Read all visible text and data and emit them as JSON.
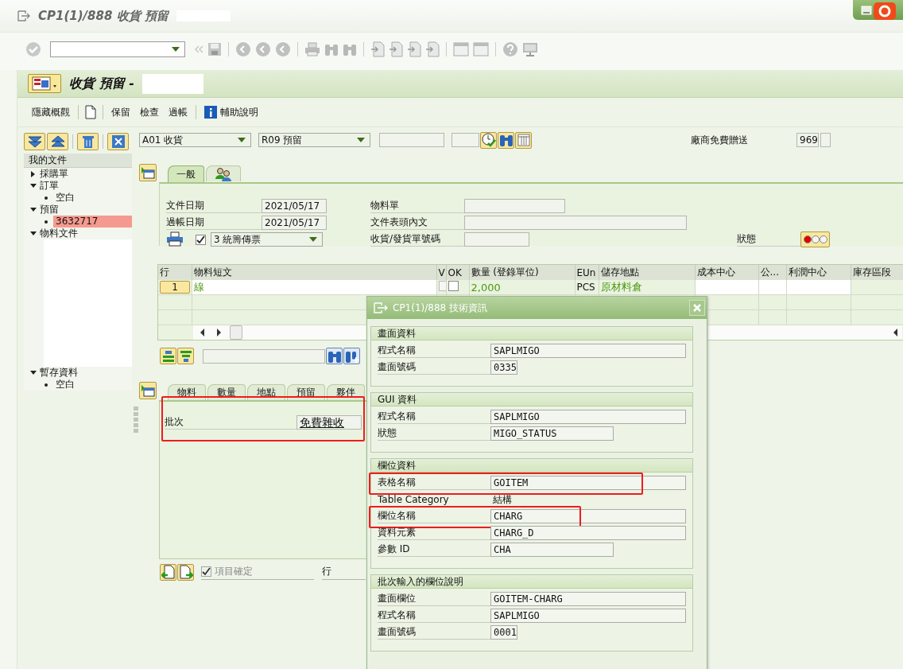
{
  "window": {
    "title": "CP1(1)/888 收貨 預留"
  },
  "header": {
    "title": "收貨 預留 -"
  },
  "app_toolbar": {
    "buttons": [
      "隱藏概觀",
      "保留",
      "檢查",
      "過帳",
      "輔助說明"
    ]
  },
  "sidebar": {
    "header": "我的文件",
    "tree": [
      {
        "label": "採購單",
        "expanded": false,
        "selected": false
      },
      {
        "label": "訂單",
        "expanded": true,
        "selected": false,
        "children": [
          {
            "label": "空白",
            "selected": false
          }
        ]
      },
      {
        "label": "預留",
        "expanded": true,
        "selected": false,
        "children": [
          {
            "label": "3632717",
            "selected": true
          }
        ]
      },
      {
        "label": "物料文件",
        "expanded": true,
        "selected": false
      }
    ],
    "held": [
      {
        "label": "暫存資料",
        "expanded": true,
        "selected": false,
        "children": [
          {
            "label": "空白",
            "selected": false
          }
        ]
      }
    ]
  },
  "selection": {
    "action": "A01 收貨",
    "reference": "R09 預留",
    "vendor_label": "廠商免費贈送",
    "vendor_value": "969"
  },
  "header_tabs": [
    {
      "kind": "text",
      "label": "一般",
      "selected": true
    },
    {
      "kind": "icon",
      "selected": false
    }
  ],
  "header_fields": {
    "dates": [
      {
        "label": "文件日期",
        "value": "2021/05/17"
      },
      {
        "label": "過帳日期",
        "value": "2021/05/17"
      }
    ],
    "print_checked": true,
    "print_version": "3 統籌傳票",
    "texts": [
      {
        "label": "物料單"
      },
      {
        "label": "文件表頭內文"
      },
      {
        "label": "收貨/發貨單號碼"
      }
    ],
    "status_label": "狀態",
    "status_light": {
      "red": true,
      "yellow": false,
      "green": false
    }
  },
  "items_table": {
    "columns": [
      "行",
      "物料短文",
      "V",
      "OK",
      "數量 (登錄單位)",
      "EUn",
      "儲存地點",
      "成本中心",
      "公...",
      "利潤中心",
      "庫存區段"
    ],
    "rows": [
      {
        "line": "1",
        "text": "線",
        "v": false,
        "ok": false,
        "quantity": "2,000",
        "unit": "PCS",
        "storage": "原材料倉"
      }
    ]
  },
  "item_tabs": [
    {
      "label": "物料",
      "selected": false
    },
    {
      "label": "數量",
      "selected": false
    },
    {
      "label": "地點",
      "selected": false
    },
    {
      "label": "預留",
      "selected": false
    },
    {
      "label": "夥伴",
      "selected": false
    }
  ],
  "item_detail": {
    "batch_label": "批次",
    "batch_value": "免費雜收",
    "highlighted": true
  },
  "item_footer": {
    "confirmed": true,
    "confirm_label": "項目確定",
    "line_label": "行"
  },
  "dialog": {
    "title": "CP1(1)/888 技術資訊",
    "groups": [
      {
        "title": "畫面資料",
        "rows": [
          {
            "kind": "field",
            "label": "程式名稱",
            "value": "SAPLMIGO",
            "highlighted": false
          },
          {
            "kind": "field",
            "label": "畫面號碼",
            "value": "0335",
            "highlighted": false
          }
        ]
      },
      {
        "title": "GUI 資料",
        "rows": [
          {
            "kind": "field",
            "label": "程式名稱",
            "value": "SAPLMIGO",
            "highlighted": false
          },
          {
            "kind": "field",
            "label": "狀態",
            "value": "MIGO_STATUS",
            "highlighted": false
          }
        ]
      },
      {
        "title": "欄位資料",
        "rows": [
          {
            "kind": "field",
            "label": "表格名稱",
            "value": "GOITEM",
            "highlighted": true
          },
          {
            "kind": "text",
            "label": "Table Category",
            "value": "結構",
            "highlighted": false
          },
          {
            "kind": "field",
            "label": "欄位名稱",
            "value": "CHARG",
            "highlighted": true
          },
          {
            "kind": "field",
            "label": "資料元素",
            "value": "CHARG_D",
            "highlighted": false
          },
          {
            "kind": "field",
            "label": "參數 ID",
            "value": "CHA",
            "highlighted": false
          }
        ]
      },
      {
        "title": "批次輸入的欄位說明",
        "rows": [
          {
            "kind": "field",
            "label": "畫面欄位",
            "value": "GOITEM-CHARG",
            "highlighted": false
          },
          {
            "kind": "field",
            "label": "程式名稱",
            "value": "SAPLMIGO",
            "highlighted": false
          },
          {
            "kind": "field",
            "label": "畫面號碼",
            "value": "0001",
            "highlighted": false
          }
        ]
      }
    ]
  }
}
